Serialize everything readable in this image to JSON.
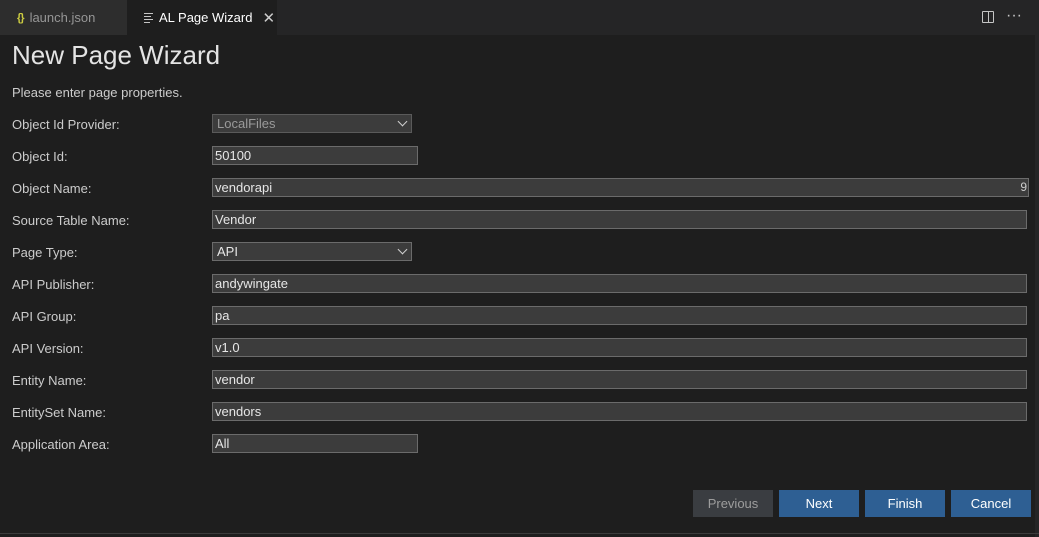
{
  "tabs": [
    {
      "label": "launch.json",
      "icon": "json-braces-icon",
      "active": false
    },
    {
      "label": "AL Page Wizard",
      "icon": "preview-lines-icon",
      "active": true
    }
  ],
  "tab_icons": {
    "json": "{}",
    "close": "✕",
    "more": "···"
  },
  "title": "New Page Wizard",
  "subtitle": "Please enter page properties.",
  "fields": {
    "object_id_provider": {
      "label": "Object Id Provider:",
      "value": "LocalFiles"
    },
    "object_id": {
      "label": "Object Id:",
      "value": "50100"
    },
    "object_name": {
      "label": "Object Name:",
      "value": "vendorapi",
      "counter": "9"
    },
    "source_table": {
      "label": "Source Table Name:",
      "value": "Vendor"
    },
    "page_type": {
      "label": "Page Type:",
      "value": "API"
    },
    "api_publisher": {
      "label": "API Publisher:",
      "value": "andywingate"
    },
    "api_group": {
      "label": "API Group:",
      "value": "pa"
    },
    "api_version": {
      "label": "API Version:",
      "value": "v1.0"
    },
    "entity_name": {
      "label": "Entity Name:",
      "value": "vendor"
    },
    "entityset_name": {
      "label": "EntitySet Name:",
      "value": "vendors"
    },
    "application_area": {
      "label": "Application Area:",
      "value": "All"
    }
  },
  "buttons": {
    "previous": "Previous",
    "next": "Next",
    "finish": "Finish",
    "cancel": "Cancel"
  },
  "colors": {
    "background": "#1e1e1e",
    "tabbar": "#252526",
    "input_bg": "#3c3c3c",
    "primary_button": "#2e5f93",
    "disabled_button": "#3a3d41"
  }
}
